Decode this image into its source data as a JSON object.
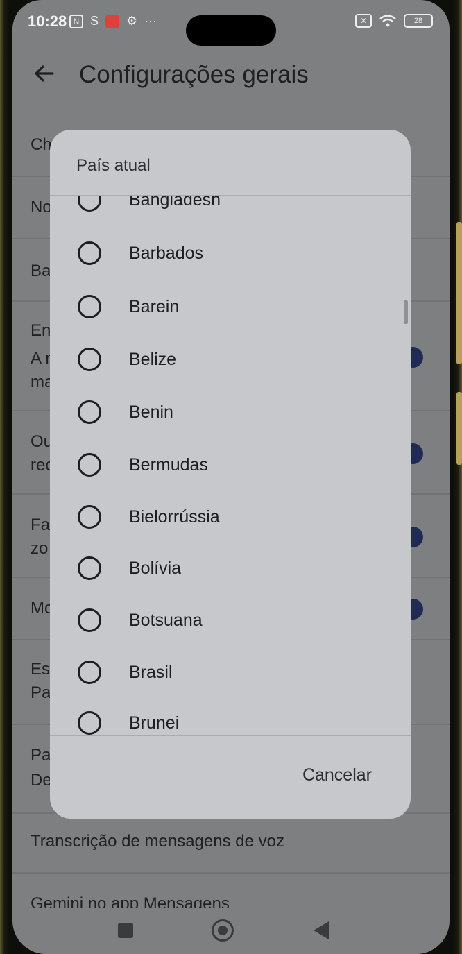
{
  "status_bar": {
    "time": "10:28",
    "left_icons": [
      "nfc-icon",
      "s-app-icon",
      "mail-app-icon",
      "gear-icon",
      "more-dots-icon"
    ],
    "right_icons": [
      "sim-icon",
      "wifi-icon",
      "battery-icon"
    ],
    "battery_level": "28"
  },
  "header": {
    "title": "Configurações gerais"
  },
  "settings": {
    "rows": [
      {
        "line1": "Ch",
        "line2": ""
      },
      {
        "line1": "No",
        "line2": ""
      },
      {
        "line1": "Ba",
        "line2": ""
      },
      {
        "line1": "En",
        "line2": "A r",
        "line3": "ma"
      },
      {
        "line1": "Ou",
        "line2": "rec"
      },
      {
        "line1": "Fa",
        "line2": "zo"
      },
      {
        "line1": "Mo",
        "line2": ""
      },
      {
        "line1": "Es",
        "line2": "Pa"
      },
      {
        "line1": "Pa",
        "line2": "De"
      },
      {
        "line1": "Transcrição de mensagens de voz",
        "line2": ""
      },
      {
        "line1": "Gemini no app Mensagens",
        "line2": ""
      }
    ]
  },
  "dialog": {
    "title": "País atual",
    "countries": [
      "Bangladesh",
      "Barbados",
      "Barein",
      "Belize",
      "Benin",
      "Bermudas",
      "Bielorrússia",
      "Bolívia",
      "Botsuana",
      "Brasil",
      "Brunei"
    ],
    "cancel_label": "Cancelar"
  },
  "colors": {
    "dim_background": "#7e7f81",
    "dialog_background": "#c6c8cc",
    "toggle_on": "#1f2b55"
  }
}
